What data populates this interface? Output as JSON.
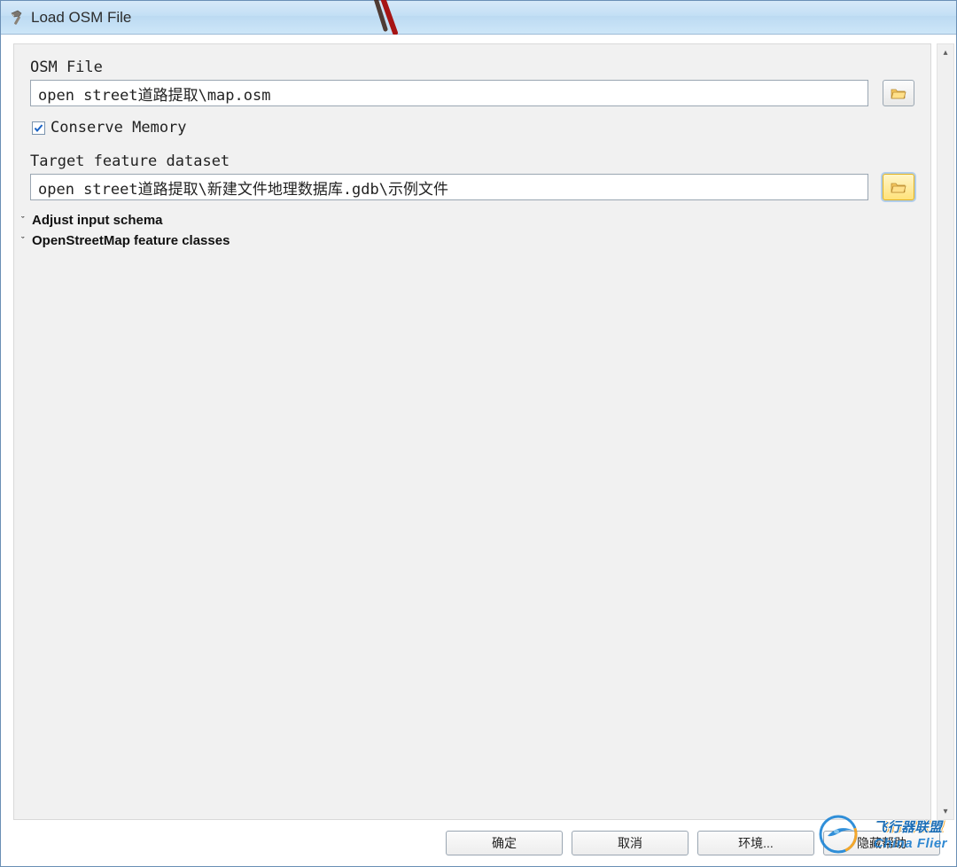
{
  "window": {
    "title": "Load OSM File"
  },
  "form": {
    "osm_file_label": "OSM File",
    "osm_file_value": "open street道路提取\\map.osm",
    "conserve_memory_label": "Conserve Memory",
    "conserve_memory_checked": true,
    "target_dataset_label": "Target feature dataset",
    "target_dataset_value": "open street道路提取\\新建文件地理数据库.gdb\\示例文件",
    "sections": [
      {
        "label": "Adjust input schema"
      },
      {
        "label": "OpenStreetMap feature classes"
      }
    ]
  },
  "buttons": {
    "ok": "确定",
    "cancel": "取消",
    "environments": "环境...",
    "hide_help": "隐藏帮助"
  },
  "watermark": {
    "line1": "飞行器联盟",
    "line2": "China Flier"
  },
  "icons": {
    "hammer": "hammer-icon",
    "folder": "folder-open-icon",
    "chevron": "chevron-down-icon",
    "check": "check-icon"
  }
}
